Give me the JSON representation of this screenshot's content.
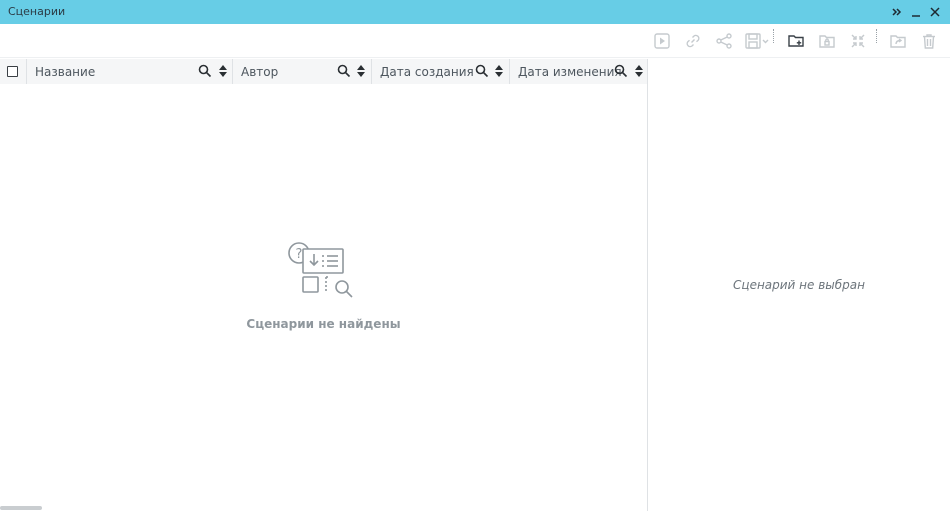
{
  "window": {
    "title": "Сценарии"
  },
  "toolbar": {
    "buttons": [
      {
        "icon": "play-icon",
        "enabled": false
      },
      {
        "icon": "link-icon",
        "enabled": false
      },
      {
        "icon": "share-icon",
        "enabled": false
      },
      {
        "icon": "save-dropdown-icon",
        "enabled": false
      },
      {
        "icon": "new-folder-icon",
        "enabled": true
      },
      {
        "icon": "locked-folder-icon",
        "enabled": false
      },
      {
        "icon": "collapse-icon",
        "enabled": false
      },
      {
        "icon": "open-folder-icon",
        "enabled": false
      },
      {
        "icon": "trash-icon",
        "enabled": false
      }
    ]
  },
  "table": {
    "columns": [
      {
        "label": "Название"
      },
      {
        "label": "Автор"
      },
      {
        "label": "Дата создания"
      },
      {
        "label": "Дата изменения"
      }
    ],
    "empty_message": "Сценарии не найдены"
  },
  "details": {
    "placeholder": "Сценарий не выбран"
  },
  "colors": {
    "titlebar": "#67cde6",
    "icon_disabled": "#c5cace",
    "icon_active": "#3a4148",
    "empty_text": "#8f979d"
  }
}
